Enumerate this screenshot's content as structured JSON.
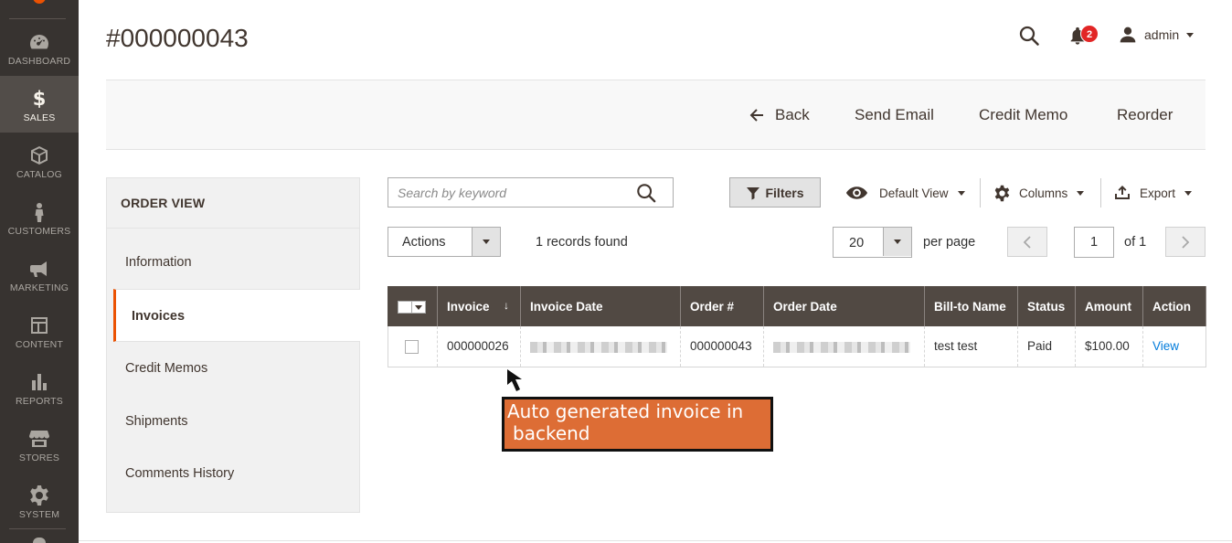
{
  "sidebar": {
    "items": [
      {
        "label": "DASHBOARD",
        "icon": "dashboard-icon",
        "active": false
      },
      {
        "label": "SALES",
        "icon": "dollar-icon",
        "active": true
      },
      {
        "label": "CATALOG",
        "icon": "box-icon",
        "active": false
      },
      {
        "label": "CUSTOMERS",
        "icon": "person-icon",
        "active": false
      },
      {
        "label": "MARKETING",
        "icon": "megaphone-icon",
        "active": false
      },
      {
        "label": "CONTENT",
        "icon": "layout-icon",
        "active": false
      },
      {
        "label": "REPORTS",
        "icon": "bar-chart-icon",
        "active": false
      },
      {
        "label": "STORES",
        "icon": "store-icon",
        "active": false
      },
      {
        "label": "SYSTEM",
        "icon": "gear-icon",
        "active": false
      }
    ],
    "dollar_glyph": "$"
  },
  "header": {
    "title": "#000000043",
    "notifications_count": "2",
    "user_name": "admin"
  },
  "action_bar": {
    "back": "Back",
    "send_email": "Send Email",
    "credit_memo": "Credit Memo",
    "reorder": "Reorder"
  },
  "order_view": {
    "title": "ORDER VIEW",
    "tabs": [
      {
        "label": "Information",
        "active": false
      },
      {
        "label": "Invoices",
        "active": true
      },
      {
        "label": "Credit Memos",
        "active": false
      },
      {
        "label": "Shipments",
        "active": false
      },
      {
        "label": "Comments History",
        "active": false
      }
    ]
  },
  "grid_controls": {
    "search_placeholder": "Search by keyword",
    "filters": "Filters",
    "default_view": "Default View",
    "columns": "Columns",
    "export": "Export",
    "actions": "Actions",
    "records_found": "1 records found",
    "per_page_value": "20",
    "per_page_label": "per page",
    "page_current": "1",
    "page_of": "of 1"
  },
  "table": {
    "headers": [
      "Invoice",
      "Invoice Date",
      "Order #",
      "Order Date",
      "Bill-to Name",
      "Status",
      "Amount",
      "Action"
    ],
    "sort_glyph": "↓",
    "rows": [
      {
        "invoice": "000000026",
        "order": "000000043",
        "bill_to": "test test",
        "status": "Paid",
        "amount": "$100.00",
        "action": "View"
      }
    ]
  },
  "annotation": {
    "line1": "Auto generated invoice in",
    "line2": "backend"
  },
  "colors": {
    "sidebar_bg": "#373330",
    "sidebar_active": "#524d49",
    "accent_orange": "#eb5202",
    "table_header": "#514943",
    "annotation_bg": "#dd6d35",
    "badge_red": "#e22626",
    "link_blue": "#007bdb"
  }
}
